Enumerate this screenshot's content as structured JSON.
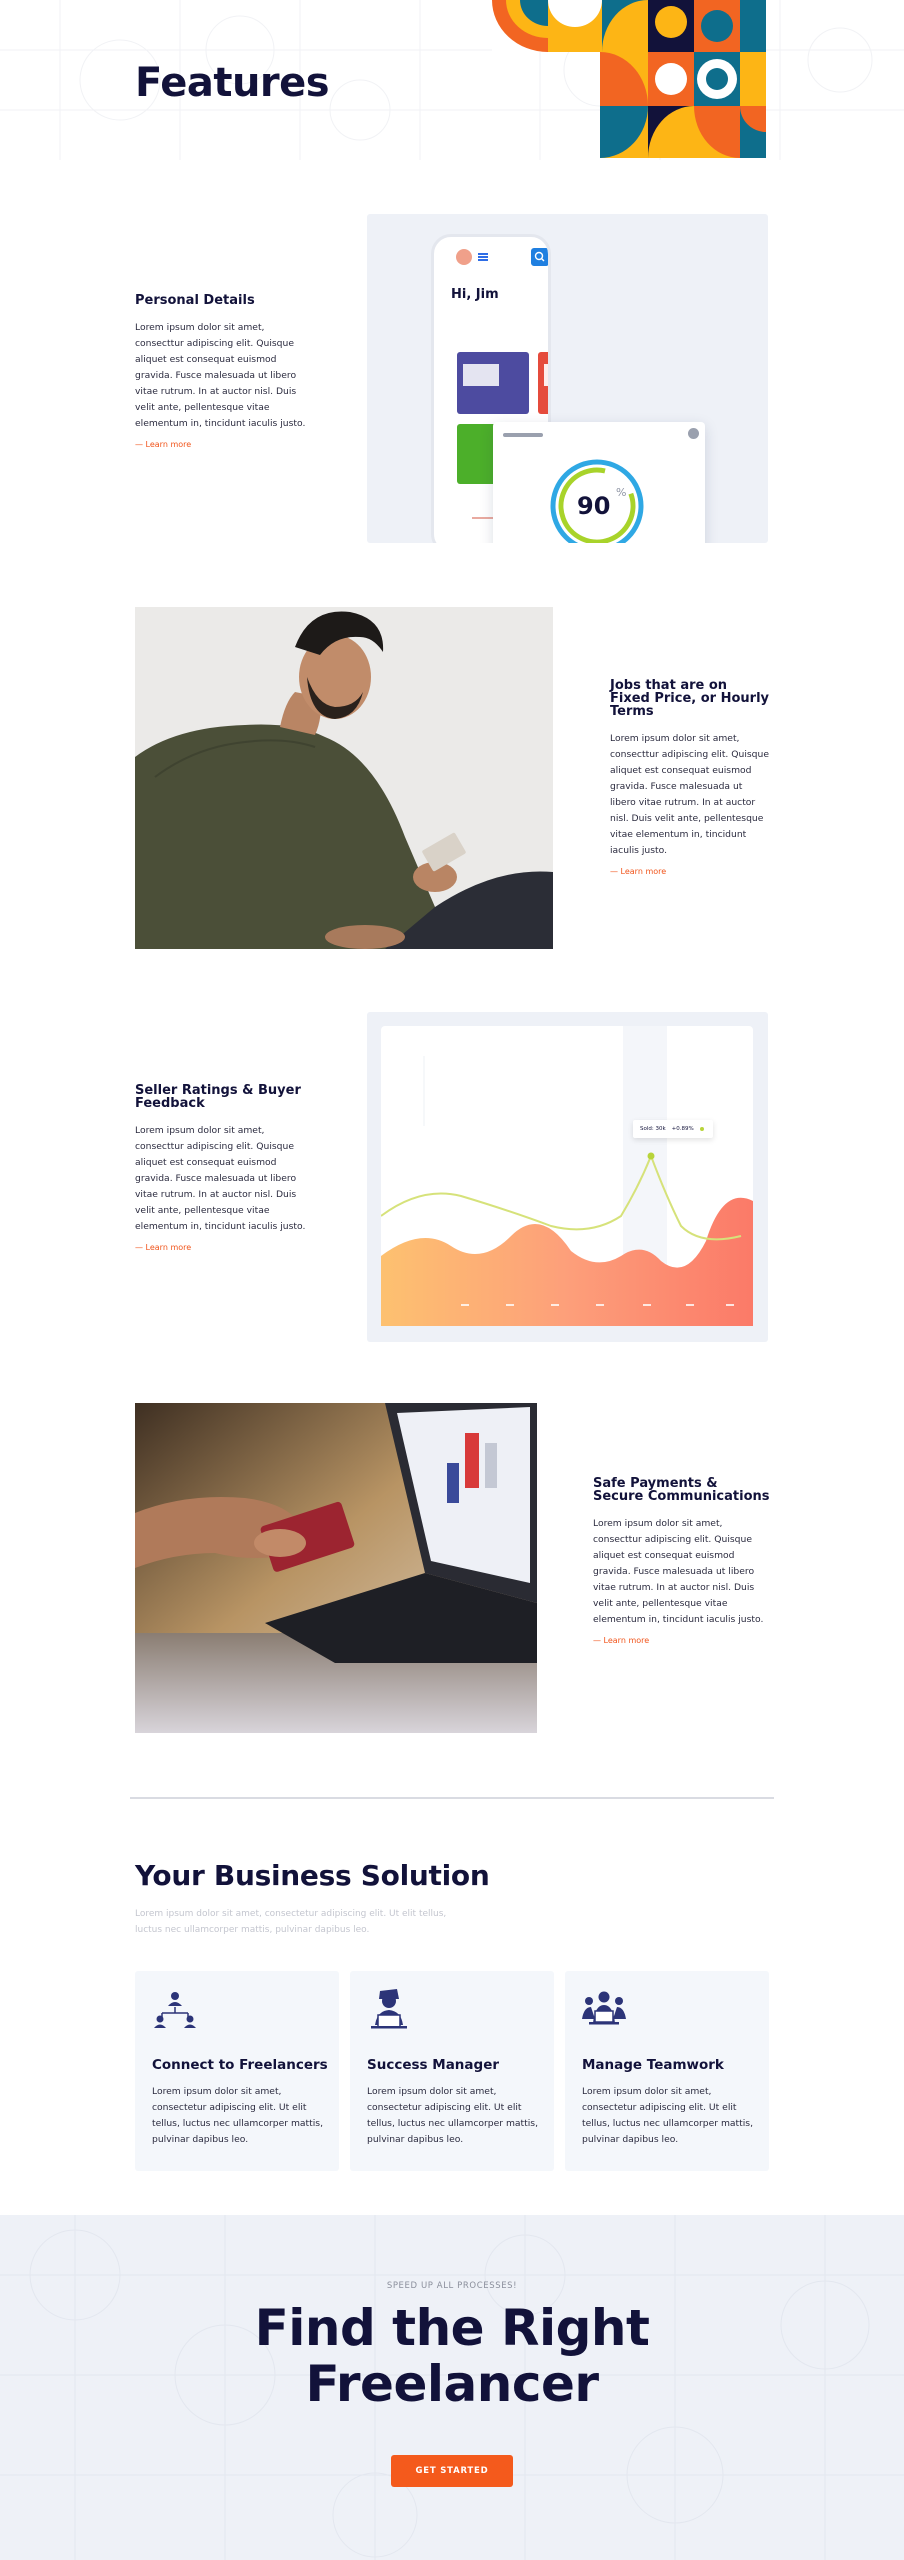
{
  "page": {
    "title": "Features"
  },
  "features": [
    {
      "title": "Personal Details",
      "text": "Lorem ipsum dolor sit amet, consecttur adipiscing elit. Quisque aliquet est consequat euismod gravida. Fusce malesuada ut libero vitae rutrum. In at auctor nisl. Duis velit ante, pellentesque vitae elementum in, tincidunt iaculis justo.",
      "link": "— Learn more"
    },
    {
      "title": "Jobs that are on Fixed Price, or Hourly Terms",
      "text": "Lorem ipsum dolor sit amet, consecttur adipiscing elit. Quisque aliquet est consequat euismod gravida. Fusce malesuada ut libero vitae rutrum. In at auctor nisl. Duis velit ante, pellentesque vitae elementum in, tincidunt iaculis justo.",
      "link": "— Learn more"
    },
    {
      "title": "Seller Ratings & Buyer Feedback",
      "text": "Lorem ipsum dolor sit amet, consecttur adipiscing elit. Quisque aliquet est consequat euismod gravida. Fusce malesuada ut libero vitae rutrum. In at auctor nisl. Duis velit ante, pellentesque vitae elementum in, tincidunt iaculis justo.",
      "link": "— Learn more"
    },
    {
      "title": "Safe Payments & Secure Communications",
      "text": "Lorem ipsum dolor sit amet, consecttur adipiscing elit. Quisque aliquet est consequat euismod gravida. Fusce malesuada ut libero vitae rutrum. In at auctor nisl. Duis velit ante, pellentesque vitae elementum in, tincidunt iaculis justo.",
      "link": "— Learn more"
    }
  ],
  "phone_mockup": {
    "greeting": "Hi, Jim",
    "score": "90",
    "percent_sign": "%"
  },
  "chart_widget": {
    "tooltip_label": "Sold: 30k",
    "tooltip_value": "+0.89%"
  },
  "business": {
    "title": "Your Business Solution",
    "subtitle": "Lorem ipsum dolor sit amet, consectetur adipiscing elit. Ut elit tellus, luctus nec ullamcorper mattis, pulvinar dapibus leo.",
    "cards": [
      {
        "icon": "network-users-icon",
        "title": "Connect to Freelancers",
        "text": "Lorem ipsum dolor sit amet, consectetur adipiscing elit. Ut elit tellus, luctus nec ullamcorper mattis, pulvinar dapibus leo."
      },
      {
        "icon": "manager-laptop-icon",
        "title": "Success Manager",
        "text": "Lorem ipsum dolor sit amet, consectetur adipiscing elit. Ut elit tellus, luctus nec ullamcorper mattis, pulvinar dapibus leo."
      },
      {
        "icon": "team-laptop-icon",
        "title": "Manage Teamwork",
        "text": "Lorem ipsum dolor sit amet, consectetur adipiscing elit. Ut elit tellus, luctus nec ullamcorper mattis, pulvinar dapibus leo."
      }
    ]
  },
  "cta": {
    "eyebrow": "SPEED UP ALL PROCESSES!",
    "title_line1": "Find the Right",
    "title_line2": "Freelancer",
    "button": "GET STARTED"
  },
  "colors": {
    "accent": "#f45a1c",
    "navy": "#12123a",
    "panel": "#eef1f7",
    "teal": "#0e6e8c",
    "yellow": "#fdb515",
    "orange": "#f26522"
  }
}
